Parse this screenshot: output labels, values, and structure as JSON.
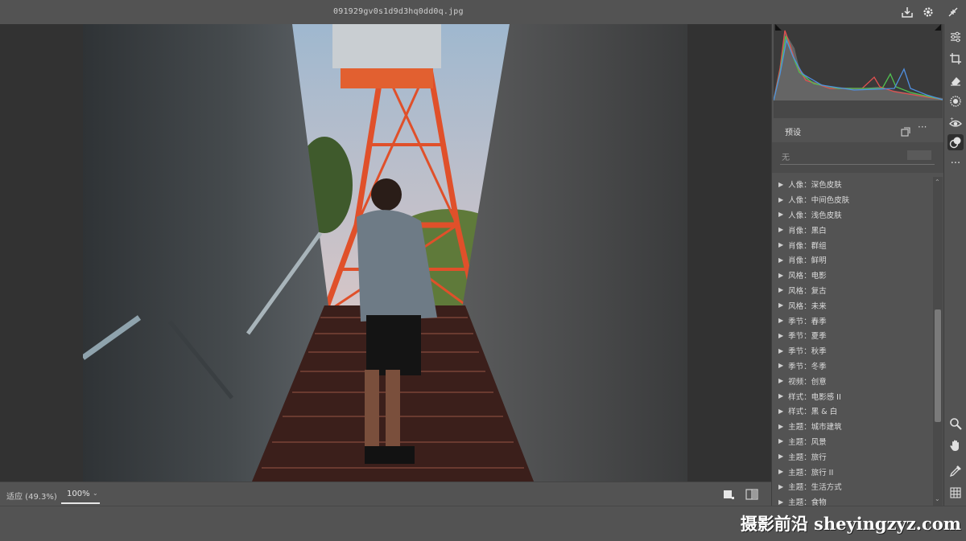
{
  "window": {
    "filename": "091929gv0s1d9d3hq0dd0q.jpg"
  },
  "statusbar": {
    "fit_label": "适应 (49.3%)",
    "zoom_value": "100%"
  },
  "presets_panel": {
    "title": "预设",
    "search_placeholder": "无",
    "items": [
      "人像：深色皮肤",
      "人像：中间色皮肤",
      "人像：浅色皮肤",
      "肖像：黑白",
      "肖像：群组",
      "肖像：鲜明",
      "风格：电影",
      "风格：复古",
      "风格：未来",
      "季节：春季",
      "季节：夏季",
      "季节：秋季",
      "季节：冬季",
      "视频：创意",
      "样式：电影感 II",
      "样式：黑 & 白",
      "主题：城市建筑",
      "主题：风景",
      "主题：旅行",
      "主题：旅行 II",
      "主题：生活方式",
      "主题：食物"
    ]
  },
  "watermark": {
    "text": "摄影前沿 sheyingzyz.com"
  },
  "icons": {
    "export": "export-icon",
    "settings": "gear-icon",
    "collapse": "collapse-icon"
  },
  "colors": {
    "panel": "#535353",
    "canvas": "#323232",
    "histogram_bg": "#3a3a3a",
    "tower_orange": "#e0502a"
  }
}
